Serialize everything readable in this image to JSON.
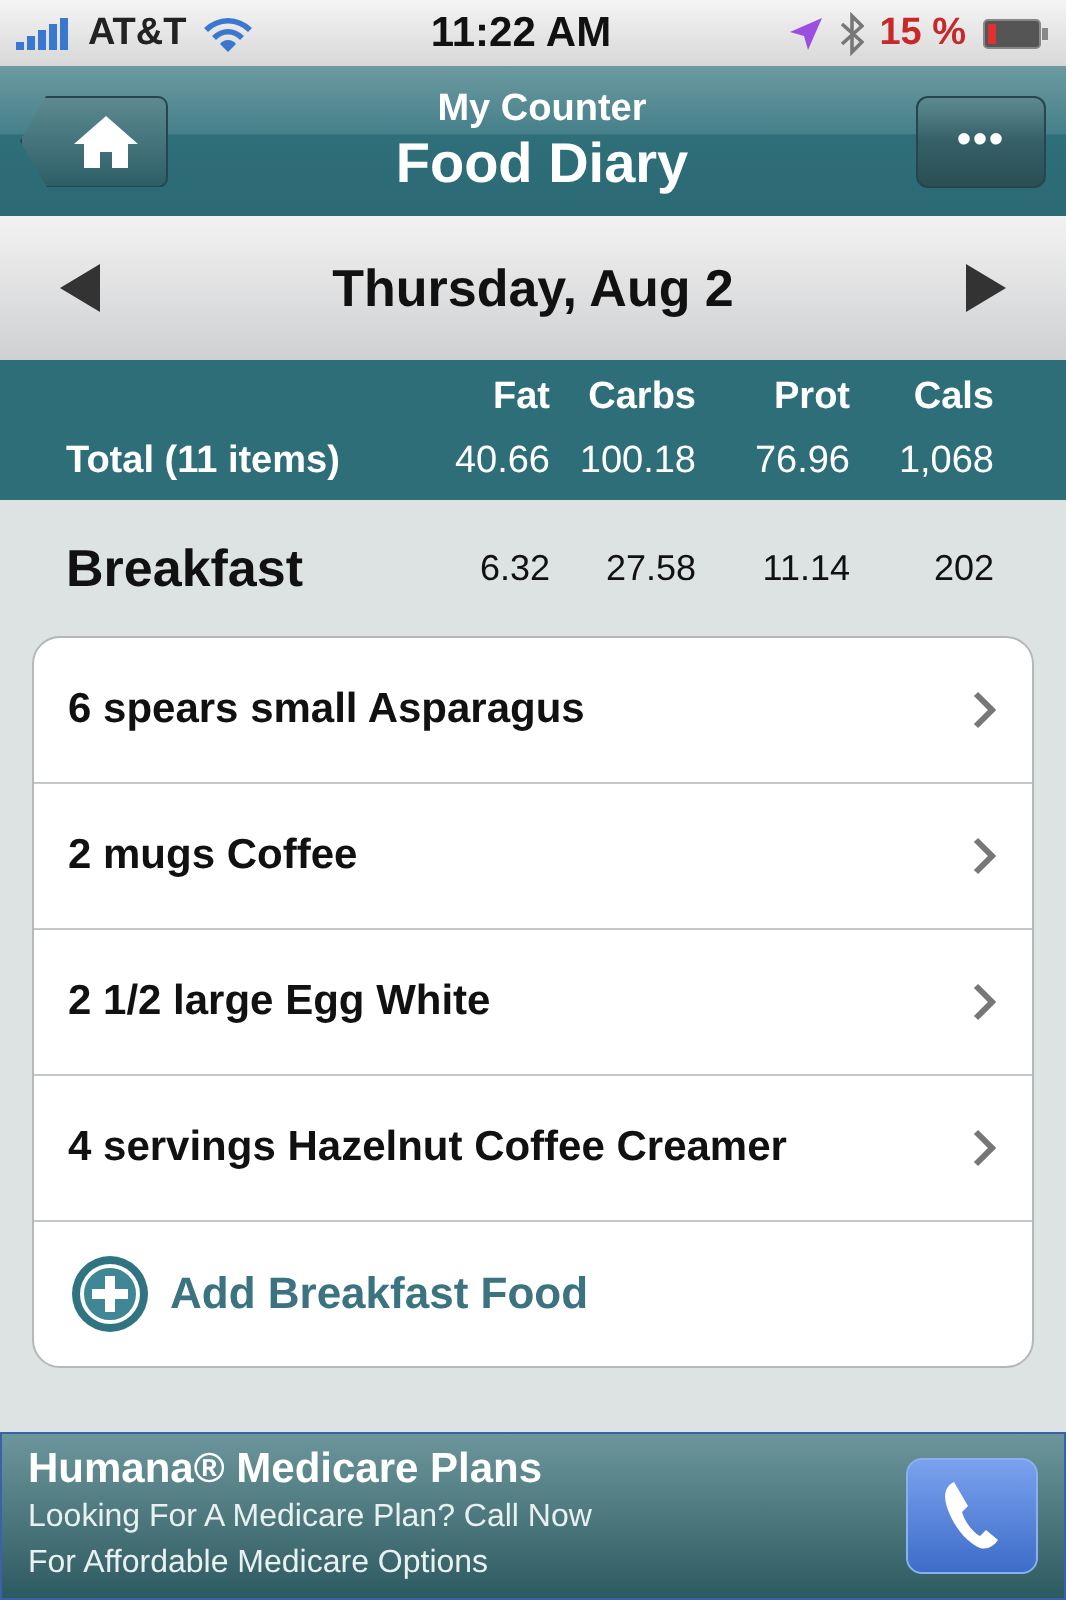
{
  "status_bar": {
    "carrier": "AT&T",
    "time": "11:22 AM",
    "battery": "15 %"
  },
  "nav": {
    "subtitle": "My Counter",
    "title": "Food Diary",
    "more_button": "•••"
  },
  "date_bar": {
    "date": "Thursday, Aug 2"
  },
  "totals": {
    "columns": [
      "Fat",
      "Carbs",
      "Prot",
      "Cals"
    ],
    "label": "Total (11 items)",
    "values": [
      "40.66",
      "100.18",
      "76.96",
      "1,068"
    ]
  },
  "meal": {
    "name": "Breakfast",
    "values": [
      "6.32",
      "27.58",
      "11.14",
      "202"
    ],
    "items": [
      {
        "name": "6 spears small Asparagus"
      },
      {
        "name": "2 mugs Coffee"
      },
      {
        "name": "2 1/2 large Egg White"
      },
      {
        "name": "4 servings Hazelnut Coffee Creamer"
      }
    ],
    "add_label": "Add Breakfast Food"
  },
  "ad": {
    "title": "Humana® Medicare Plans",
    "lines": [
      "Looking For A Medicare Plan? Call Now",
      "For Affordable Medicare Options"
    ]
  }
}
